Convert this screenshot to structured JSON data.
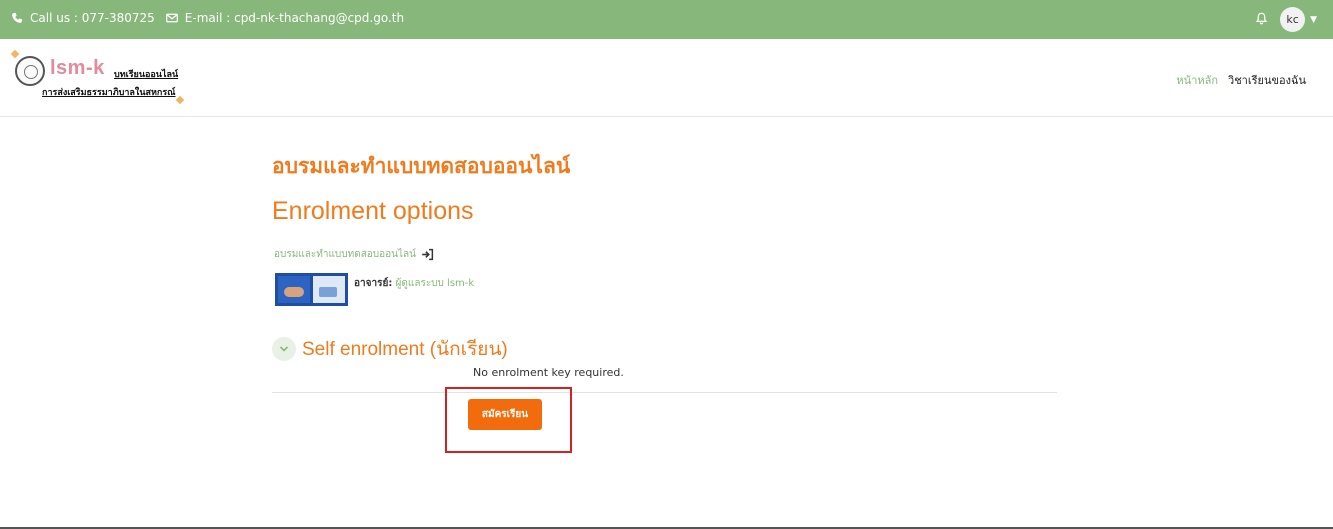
{
  "topbar": {
    "phone_text": "Call us : 077-380725",
    "email_text": "E-mail : cpd-nk-thachang@cpd.go.th",
    "avatar_initials": "kc"
  },
  "header": {
    "logo_text": "lsm-k",
    "logo_subtitle_1": "บทเรียนออนไลน์",
    "logo_subtitle_2": "การส่งเสริมธรรมาภิบาลในสหกรณ์",
    "nav": {
      "home": "หน้าหลัก",
      "my_courses": "วิชาเรียนของฉัน"
    }
  },
  "main": {
    "course_title": "อบรมและทำแบบทดสอบออนไลน์",
    "page_heading": "Enrolment options",
    "course_link": "อบรมและทำแบบทดสอบออนไลน์",
    "teacher_label": "อาจารย์:",
    "teacher_name": "ผู้ดูแลระบบ lsm-k",
    "section_title": "Self enrolment (นักเรียน)",
    "no_key_text": "No enrolment key required.",
    "enrol_button": "สมัครเรียน"
  },
  "colors": {
    "topbar_bg": "#88b77b",
    "accent_orange": "#f07b1d",
    "button_orange": "#f26c0d",
    "link_green": "#88b77b",
    "highlight_red": "#d42121"
  },
  "icons": {
    "phone": "phone-icon",
    "email": "envelope-icon",
    "bell": "bell-icon",
    "caret": "chevron-down-icon",
    "enter": "sign-in-icon",
    "collapse": "chevron-down-icon"
  }
}
